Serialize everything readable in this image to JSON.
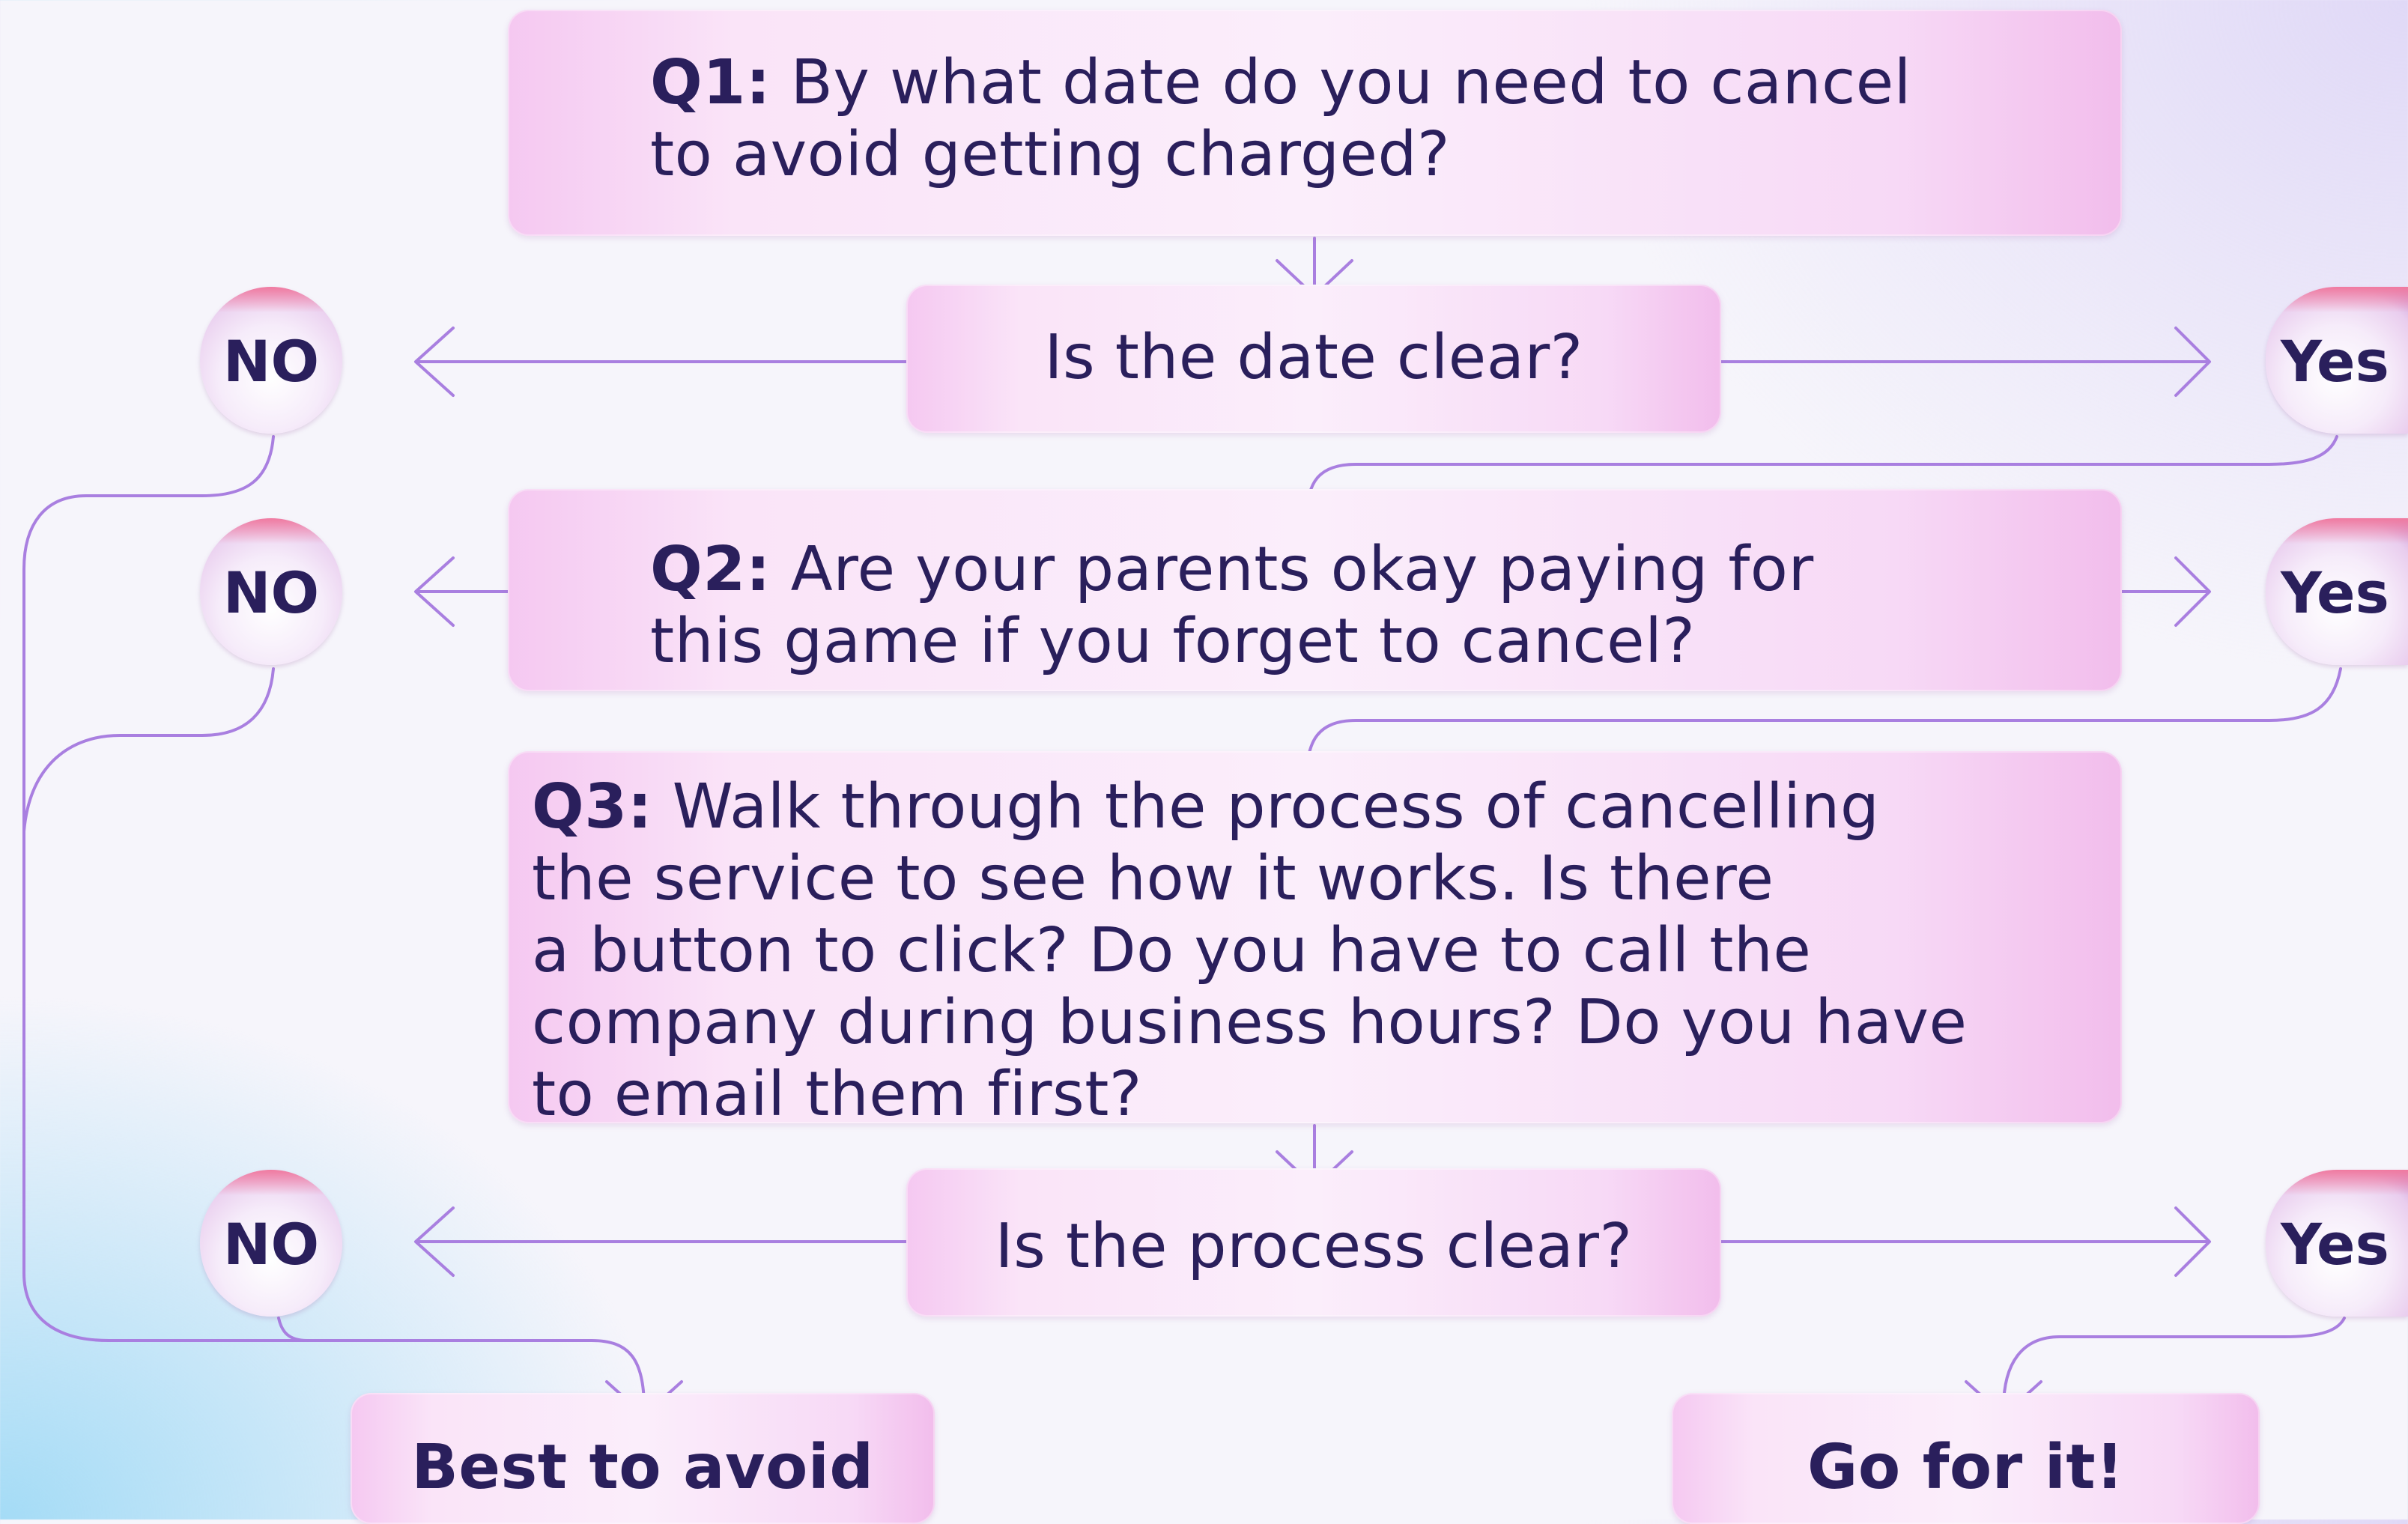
{
  "q1": {
    "label": "Q1:",
    "line1": "By what date do you need to cancel",
    "line2": "to avoid getting charged?"
  },
  "check1": {
    "text": "Is the date clear?"
  },
  "q2": {
    "label": "Q2:",
    "line1": "Are your parents okay paying for",
    "line2": "this game if you forget to cancel?"
  },
  "q3": {
    "label": "Q3:",
    "line1": "Walk through the process of cancelling",
    "line2": "the service to see how it works. Is there",
    "line3": "a button to click? Do you have to call the",
    "line4": "company during business hours? Do you have",
    "line5": "to email them first?"
  },
  "check2": {
    "text": "Is the process clear?"
  },
  "no_label": "NO",
  "yes_label": "Yes",
  "outcome_avoid": "Best to avoid",
  "outcome_go": "Go for it!",
  "colors": {
    "box_pink": "#f5c8f1",
    "text_navy": "#2a1f5c",
    "line_purple": "#a97fe0",
    "circle_rim": "#f07aa0"
  }
}
